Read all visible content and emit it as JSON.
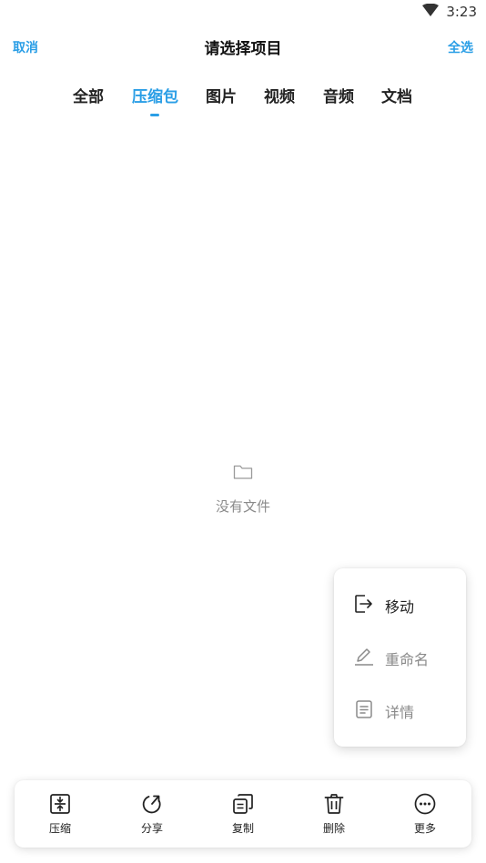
{
  "status_bar": {
    "time": "3:23"
  },
  "header": {
    "cancel": "取消",
    "title": "请选择项目",
    "select_all": "全选"
  },
  "tabs": [
    {
      "label": "全部",
      "active": false
    },
    {
      "label": "压缩包",
      "active": true
    },
    {
      "label": "图片",
      "active": false
    },
    {
      "label": "视频",
      "active": false
    },
    {
      "label": "音频",
      "active": false
    },
    {
      "label": "文档",
      "active": false
    }
  ],
  "empty_state": {
    "icon": "folder-icon",
    "message": "没有文件"
  },
  "popup_menu": [
    {
      "label": "移动",
      "icon": "move-icon",
      "enabled": true
    },
    {
      "label": "重命名",
      "icon": "rename-icon",
      "enabled": false
    },
    {
      "label": "详情",
      "icon": "details-icon",
      "enabled": false
    }
  ],
  "bottom_bar": [
    {
      "label": "压缩",
      "icon": "compress-icon"
    },
    {
      "label": "分享",
      "icon": "share-icon"
    },
    {
      "label": "复制",
      "icon": "copy-icon"
    },
    {
      "label": "删除",
      "icon": "delete-icon"
    },
    {
      "label": "更多",
      "icon": "more-icon"
    }
  ],
  "colors": {
    "accent": "#2a9ee6",
    "text": "#222222",
    "muted": "#8a8a8a"
  }
}
